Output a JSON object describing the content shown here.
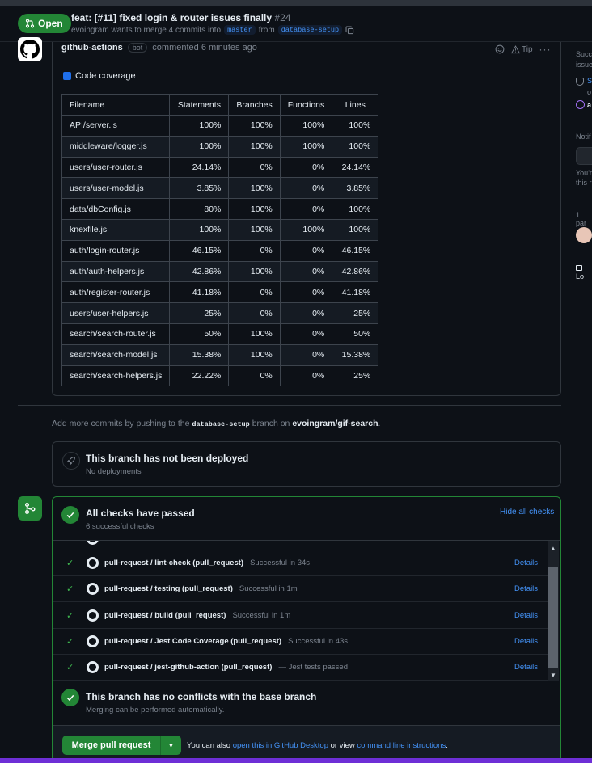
{
  "header": {
    "status": "Open",
    "title": "feat: [#11] fixed login & router issues finally",
    "number": "#24",
    "subtitle_prefix": "evoingram wants to merge 4 commits into",
    "base_branch": "master",
    "from_word": "from",
    "head_branch": "database-setup"
  },
  "comment": {
    "author": "github-actions",
    "badge": "bot",
    "meta": "commented 6 minutes ago",
    "tip_label": "Tip",
    "coverage_title": "Code coverage",
    "columns": [
      "Filename",
      "Statements",
      "Branches",
      "Functions",
      "Lines"
    ],
    "rows": [
      [
        "API/server.js",
        "100%",
        "100%",
        "100%",
        "100%"
      ],
      [
        "middleware/logger.js",
        "100%",
        "100%",
        "100%",
        "100%"
      ],
      [
        "users/user-router.js",
        "24.14%",
        "0%",
        "0%",
        "24.14%"
      ],
      [
        "users/user-model.js",
        "3.85%",
        "100%",
        "0%",
        "3.85%"
      ],
      [
        "data/dbConfig.js",
        "80%",
        "100%",
        "0%",
        "100%"
      ],
      [
        "knexfile.js",
        "100%",
        "100%",
        "100%",
        "100%"
      ],
      [
        "auth/login-router.js",
        "46.15%",
        "0%",
        "0%",
        "46.15%"
      ],
      [
        "auth/auth-helpers.js",
        "42.86%",
        "100%",
        "0%",
        "42.86%"
      ],
      [
        "auth/register-router.js",
        "41.18%",
        "0%",
        "0%",
        "41.18%"
      ],
      [
        "users/user-helpers.js",
        "25%",
        "0%",
        "0%",
        "25%"
      ],
      [
        "search/search-router.js",
        "50%",
        "100%",
        "0%",
        "50%"
      ],
      [
        "search/search-model.js",
        "15.38%",
        "100%",
        "0%",
        "15.38%"
      ],
      [
        "search/search-helpers.js",
        "22.22%",
        "0%",
        "0%",
        "25%"
      ]
    ]
  },
  "push_note": {
    "prefix": "Add more commits by pushing to the",
    "branch": "database-setup",
    "middle": "branch on",
    "repo": "evoingram/gif-search",
    "suffix": "."
  },
  "deploy": {
    "title": "This branch has not been deployed",
    "subtitle": "No deployments"
  },
  "checks": {
    "title": "All checks have passed",
    "subtitle": "6 successful checks",
    "hide_label": "Hide all checks",
    "items": [
      {
        "name": "pull-request / lint-check (pull_request)",
        "status": "Successful in 34s",
        "details": "Details"
      },
      {
        "name": "pull-request / testing (pull_request)",
        "status": "Successful in 1m",
        "details": "Details"
      },
      {
        "name": "pull-request / build (pull_request)",
        "status": "Successful in 1m",
        "details": "Details"
      },
      {
        "name": "pull-request / Jest Code Coverage (pull_request)",
        "status": "Successful in 43s",
        "details": "Details"
      },
      {
        "name": "pull-request / jest-github-action (pull_request)",
        "status": "— Jest tests passed",
        "details": "Details"
      }
    ]
  },
  "conflicts": {
    "title": "This branch has no conflicts with the base branch",
    "subtitle": "Merging can be performed automatically."
  },
  "merge": {
    "button": "Merge pull request",
    "note_prefix": "You can also",
    "link1": "open this in GitHub Desktop",
    "note_middle": "or view",
    "link2": "command line instructions",
    "note_suffix": "."
  },
  "sidebar": {
    "t1": "Succe",
    "t2": "issue",
    "t3": "S",
    "t4": "o",
    "t5": "a",
    "notif": "Notif",
    "t6": "You'r",
    "t7": "this r",
    "participants": "1 par",
    "lock": "Lo"
  },
  "colors": {
    "accent_green": "#238636",
    "link_blue": "#4493f8",
    "background": "#0d1117"
  }
}
